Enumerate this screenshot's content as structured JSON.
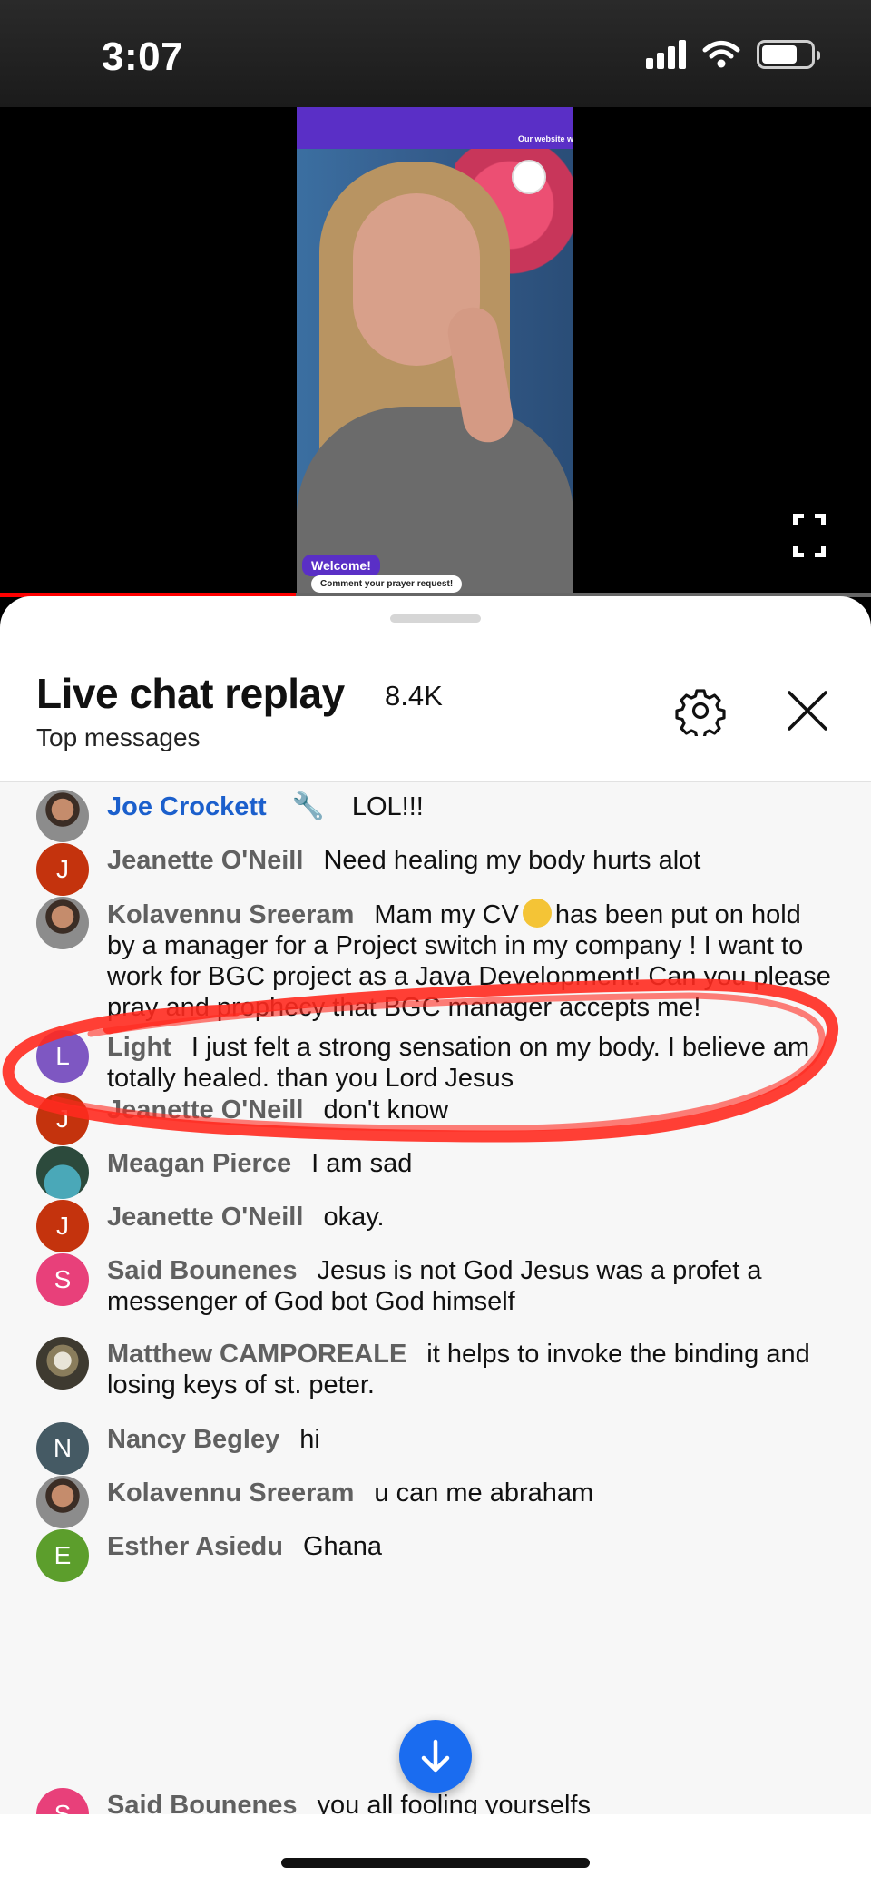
{
  "status_bar": {
    "time": "3:07",
    "icons": [
      "signal-icon",
      "wifi-icon",
      "battery-icon"
    ]
  },
  "video": {
    "overlay_site_text": "Our website w",
    "welcome_label": "Welcome!",
    "comment_label": "Comment your prayer request!",
    "progress_fraction": 0.34
  },
  "chat": {
    "title": "Live chat replay",
    "count": "8.4K",
    "subtitle": "Top messages"
  },
  "messages": [
    {
      "author": "Joe Crockett",
      "text": "LOL!!!",
      "avatar": "photo",
      "owner": true
    },
    {
      "author": "Jeanette O'Neill",
      "text": "Need healing my body hurts alot",
      "avatar_letter": "J",
      "avatar_color": "#c4330d"
    },
    {
      "author": "Kolavennu Sreeram",
      "text_before": "Mam my CV",
      "text_after": "has been put on hold by a manager for a Project switch in my company ! I want to work for BGC project as a Java Development! Can you please pray and prophecy that BGC manager accepts me!",
      "avatar": "photo"
    },
    {
      "author": "Light",
      "text": "I just felt a strong sensation on my body. I believe am totally healed. than you Lord Jesus",
      "avatar_letter": "L",
      "avatar_color": "#7e57c2"
    },
    {
      "author": "Jeanette O'Neill",
      "text": "don't know",
      "avatar_letter": "J",
      "avatar_color": "#c4330d"
    },
    {
      "author": "Meagan Pierce",
      "text": "I am sad",
      "avatar": "photo"
    },
    {
      "author": "Jeanette O'Neill",
      "text": "okay.",
      "avatar_letter": "J",
      "avatar_color": "#c4330d"
    },
    {
      "author": "Said Bounenes",
      "text": "Jesus is not God Jesus was a profet a messenger of God bot God himself",
      "avatar_letter": "S",
      "avatar_color": "#e8407a"
    },
    {
      "author": "Matthew CAMPOREALE",
      "text": "it helps to invoke the binding and losing keys of st. peter.",
      "avatar": "photo"
    },
    {
      "author": "Nancy Begley",
      "text": "hi",
      "avatar_letter": "N",
      "avatar_color": "#455a64"
    },
    {
      "author": "Kolavennu Sreeram",
      "text": "u can me abraham",
      "avatar": "photo"
    },
    {
      "author": "Esther Asiedu",
      "text": "Ghana",
      "avatar_letter": "E",
      "avatar_color": "#5c9e2c"
    },
    {
      "author": "Said Bounenes",
      "text": "you all fooling yourselfs",
      "avatar_letter": "S",
      "avatar_color": "#e8407a"
    }
  ],
  "colors": {
    "owner_name": "#1b5fcc",
    "scroll_button": "#1a6cf0",
    "annotation": "#ff2a1f",
    "progress": "#ff0000"
  }
}
